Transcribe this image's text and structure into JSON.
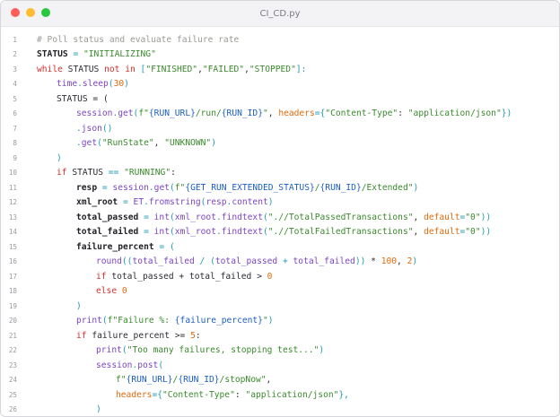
{
  "window": {
    "title": "CI_CD.py"
  },
  "colors": {
    "comment": "#9a9a96",
    "keyword": "#d0312d",
    "string": "#3b8a2e",
    "function": "#7b46c2",
    "number": "#e06a0d",
    "operator": "#1f9bb0",
    "interpolation": "#1d5fc4"
  },
  "icons": [
    "close-icon",
    "minimize-icon",
    "maximize-icon"
  ],
  "lines": [
    {
      "num": "1",
      "indent": 0,
      "tokens": [
        {
          "t": "# Poll status and evaluate failure rate",
          "c": "comment"
        }
      ]
    },
    {
      "num": "2",
      "indent": 0,
      "tokens": [
        {
          "t": "STATUS",
          "c": "bold"
        },
        {
          "t": " ",
          "c": "plain"
        },
        {
          "t": "=",
          "c": "op"
        },
        {
          "t": " ",
          "c": "plain"
        },
        {
          "t": "\"INITIALIZING\"",
          "c": "string"
        }
      ]
    },
    {
      "num": "3",
      "indent": 0,
      "tokens": [
        {
          "t": "while",
          "c": "keyword"
        },
        {
          "t": " STATUS ",
          "c": "plain"
        },
        {
          "t": "not in",
          "c": "keyword"
        },
        {
          "t": " ",
          "c": "plain"
        },
        {
          "t": "[",
          "c": "op"
        },
        {
          "t": "\"FINISHED\"",
          "c": "string"
        },
        {
          "t": ",",
          "c": "plain"
        },
        {
          "t": "\"FAILED\"",
          "c": "string"
        },
        {
          "t": ",",
          "c": "plain"
        },
        {
          "t": "\"STOPPED\"",
          "c": "string"
        },
        {
          "t": "]:",
          "c": "op"
        }
      ]
    },
    {
      "num": "4",
      "indent": 1,
      "tokens": [
        {
          "t": "time",
          "c": "func"
        },
        {
          "t": ".",
          "c": "op"
        },
        {
          "t": "sleep",
          "c": "func"
        },
        {
          "t": "(",
          "c": "op"
        },
        {
          "t": "30",
          "c": "number"
        },
        {
          "t": ")",
          "c": "op"
        }
      ]
    },
    {
      "num": "5",
      "indent": 1,
      "tokens": [
        {
          "t": "STATUS = (",
          "c": "plain"
        }
      ]
    },
    {
      "num": "6",
      "indent": 2,
      "tokens": [
        {
          "t": "session",
          "c": "func"
        },
        {
          "t": ".",
          "c": "op"
        },
        {
          "t": "get",
          "c": "func"
        },
        {
          "t": "(",
          "c": "op"
        },
        {
          "t": "f\"",
          "c": "string"
        },
        {
          "t": "{RUN_URL}",
          "c": "interp"
        },
        {
          "t": "/run/",
          "c": "string"
        },
        {
          "t": "{RUN_ID}",
          "c": "interp"
        },
        {
          "t": "\"",
          "c": "string"
        },
        {
          "t": ", ",
          "c": "plain"
        },
        {
          "t": "headers",
          "c": "param"
        },
        {
          "t": "=",
          "c": "op"
        },
        {
          "t": "{",
          "c": "op"
        },
        {
          "t": "\"Content-Type\"",
          "c": "string"
        },
        {
          "t": ": ",
          "c": "plain"
        },
        {
          "t": "\"application/json\"",
          "c": "string"
        },
        {
          "t": "})",
          "c": "op"
        }
      ]
    },
    {
      "num": "7",
      "indent": 2,
      "tokens": [
        {
          "t": ".",
          "c": "op"
        },
        {
          "t": "json",
          "c": "func"
        },
        {
          "t": "()",
          "c": "op"
        }
      ]
    },
    {
      "num": "8",
      "indent": 2,
      "tokens": [
        {
          "t": ".",
          "c": "op"
        },
        {
          "t": "get",
          "c": "func"
        },
        {
          "t": "(",
          "c": "op"
        },
        {
          "t": "\"RunState\"",
          "c": "string"
        },
        {
          "t": ", ",
          "c": "plain"
        },
        {
          "t": "\"UNKNOWN\"",
          "c": "string"
        },
        {
          "t": ")",
          "c": "op"
        }
      ]
    },
    {
      "num": "9",
      "indent": 1,
      "tokens": [
        {
          "t": ")",
          "c": "op"
        }
      ]
    },
    {
      "num": "10",
      "indent": 1,
      "tokens": [
        {
          "t": "if",
          "c": "keyword"
        },
        {
          "t": " STATUS ",
          "c": "plain"
        },
        {
          "t": "==",
          "c": "op"
        },
        {
          "t": " ",
          "c": "plain"
        },
        {
          "t": "\"RUNNING\"",
          "c": "string"
        },
        {
          "t": ":",
          "c": "plain"
        }
      ]
    },
    {
      "num": "11",
      "indent": 2,
      "tokens": [
        {
          "t": "resp",
          "c": "bold"
        },
        {
          "t": " ",
          "c": "plain"
        },
        {
          "t": "=",
          "c": "op"
        },
        {
          "t": " ",
          "c": "plain"
        },
        {
          "t": "session",
          "c": "func"
        },
        {
          "t": ".",
          "c": "op"
        },
        {
          "t": "get",
          "c": "func"
        },
        {
          "t": "(",
          "c": "op"
        },
        {
          "t": "f\"",
          "c": "string"
        },
        {
          "t": "{GET_RUN_EXTENDED_STATUS}",
          "c": "interp"
        },
        {
          "t": "/",
          "c": "string"
        },
        {
          "t": "{RUN_ID}",
          "c": "interp"
        },
        {
          "t": "/Extended\"",
          "c": "string"
        },
        {
          "t": ")",
          "c": "op"
        }
      ]
    },
    {
      "num": "12",
      "indent": 2,
      "tokens": [
        {
          "t": "xml_root",
          "c": "bold"
        },
        {
          "t": " ",
          "c": "plain"
        },
        {
          "t": "=",
          "c": "op"
        },
        {
          "t": " ET",
          "c": "func"
        },
        {
          "t": ".",
          "c": "op"
        },
        {
          "t": "fromstring",
          "c": "func"
        },
        {
          "t": "(",
          "c": "op"
        },
        {
          "t": "resp",
          "c": "func"
        },
        {
          "t": ".",
          "c": "op"
        },
        {
          "t": "content",
          "c": "func"
        },
        {
          "t": ")",
          "c": "op"
        }
      ]
    },
    {
      "num": "13",
      "indent": 2,
      "tokens": [
        {
          "t": "total_passed",
          "c": "bold"
        },
        {
          "t": " ",
          "c": "plain"
        },
        {
          "t": "=",
          "c": "op"
        },
        {
          "t": " ",
          "c": "plain"
        },
        {
          "t": "int",
          "c": "func"
        },
        {
          "t": "(",
          "c": "op"
        },
        {
          "t": "xml_root",
          "c": "func"
        },
        {
          "t": ".",
          "c": "op"
        },
        {
          "t": "findtext",
          "c": "func"
        },
        {
          "t": "(",
          "c": "op"
        },
        {
          "t": "\".//TotalPassedTransactions\"",
          "c": "string"
        },
        {
          "t": ", ",
          "c": "plain"
        },
        {
          "t": "default",
          "c": "param"
        },
        {
          "t": "=",
          "c": "op"
        },
        {
          "t": "\"0\"",
          "c": "string"
        },
        {
          "t": "))",
          "c": "op"
        }
      ]
    },
    {
      "num": "14",
      "indent": 2,
      "tokens": [
        {
          "t": "total_failed",
          "c": "bold"
        },
        {
          "t": " ",
          "c": "plain"
        },
        {
          "t": "=",
          "c": "op"
        },
        {
          "t": " ",
          "c": "plain"
        },
        {
          "t": "int",
          "c": "func"
        },
        {
          "t": "(",
          "c": "op"
        },
        {
          "t": "xml_root",
          "c": "func"
        },
        {
          "t": ".",
          "c": "op"
        },
        {
          "t": "findtext",
          "c": "func"
        },
        {
          "t": "(",
          "c": "op"
        },
        {
          "t": "\".//TotalFailedTransactions\"",
          "c": "string"
        },
        {
          "t": ", ",
          "c": "plain"
        },
        {
          "t": "default",
          "c": "param"
        },
        {
          "t": "=",
          "c": "op"
        },
        {
          "t": "\"0\"",
          "c": "string"
        },
        {
          "t": "))",
          "c": "op"
        }
      ]
    },
    {
      "num": "15",
      "indent": 2,
      "tokens": [
        {
          "t": "failure_percent",
          "c": "bold"
        },
        {
          "t": " ",
          "c": "plain"
        },
        {
          "t": "=",
          "c": "op"
        },
        {
          "t": " ",
          "c": "plain"
        },
        {
          "t": "(",
          "c": "op"
        }
      ]
    },
    {
      "num": "16",
      "indent": 3,
      "tokens": [
        {
          "t": "round",
          "c": "func"
        },
        {
          "t": "((",
          "c": "op"
        },
        {
          "t": "total_failed",
          "c": "func"
        },
        {
          "t": " / (",
          "c": "op"
        },
        {
          "t": "total_passed",
          "c": "func"
        },
        {
          "t": " + ",
          "c": "op"
        },
        {
          "t": "total_failed",
          "c": "func"
        },
        {
          "t": "))",
          "c": "op"
        },
        {
          "t": " * ",
          "c": "plain"
        },
        {
          "t": "100",
          "c": "number"
        },
        {
          "t": ", ",
          "c": "plain"
        },
        {
          "t": "2",
          "c": "number"
        },
        {
          "t": ")",
          "c": "op"
        }
      ]
    },
    {
      "num": "17",
      "indent": 3,
      "tokens": [
        {
          "t": "if",
          "c": "keyword"
        },
        {
          "t": " total_passed + total_failed > ",
          "c": "plain"
        },
        {
          "t": "0",
          "c": "number"
        }
      ]
    },
    {
      "num": "18",
      "indent": 3,
      "tokens": [
        {
          "t": "else",
          "c": "keyword"
        },
        {
          "t": " ",
          "c": "plain"
        },
        {
          "t": "0",
          "c": "number"
        }
      ]
    },
    {
      "num": "19",
      "indent": 2,
      "tokens": [
        {
          "t": ")",
          "c": "op"
        }
      ]
    },
    {
      "num": "20",
      "indent": 2,
      "tokens": [
        {
          "t": "print",
          "c": "func"
        },
        {
          "t": "(",
          "c": "op"
        },
        {
          "t": "f\"Failure %: ",
          "c": "string"
        },
        {
          "t": "{failure_percent}",
          "c": "interp"
        },
        {
          "t": "\"",
          "c": "string"
        },
        {
          "t": ")",
          "c": "op"
        }
      ]
    },
    {
      "num": "21",
      "indent": 2,
      "tokens": [
        {
          "t": "if",
          "c": "keyword"
        },
        {
          "t": " failure_percent >= ",
          "c": "plain"
        },
        {
          "t": "5",
          "c": "number"
        },
        {
          "t": ":",
          "c": "plain"
        }
      ]
    },
    {
      "num": "22",
      "indent": 3,
      "tokens": [
        {
          "t": "print",
          "c": "func"
        },
        {
          "t": "(",
          "c": "op"
        },
        {
          "t": "\"Too many failures, stopping test...\"",
          "c": "string"
        },
        {
          "t": ")",
          "c": "op"
        }
      ]
    },
    {
      "num": "23",
      "indent": 3,
      "tokens": [
        {
          "t": "session",
          "c": "func"
        },
        {
          "t": ".",
          "c": "op"
        },
        {
          "t": "post",
          "c": "func"
        },
        {
          "t": "(",
          "c": "op"
        }
      ]
    },
    {
      "num": "24",
      "indent": 4,
      "tokens": [
        {
          "t": "f\"",
          "c": "string"
        },
        {
          "t": "{RUN_URL}",
          "c": "interp"
        },
        {
          "t": "/",
          "c": "string"
        },
        {
          "t": "{RUN_ID}",
          "c": "interp"
        },
        {
          "t": "/stopNow\"",
          "c": "string"
        },
        {
          "t": ",",
          "c": "plain"
        }
      ]
    },
    {
      "num": "25",
      "indent": 4,
      "tokens": [
        {
          "t": "headers",
          "c": "param"
        },
        {
          "t": "=",
          "c": "op"
        },
        {
          "t": "{",
          "c": "op"
        },
        {
          "t": "\"Content-Type\"",
          "c": "string"
        },
        {
          "t": ": ",
          "c": "plain"
        },
        {
          "t": "\"application/json\"",
          "c": "string"
        },
        {
          "t": "},",
          "c": "op"
        }
      ]
    },
    {
      "num": "26",
      "indent": 3,
      "tokens": [
        {
          "t": ")",
          "c": "op"
        }
      ]
    }
  ]
}
